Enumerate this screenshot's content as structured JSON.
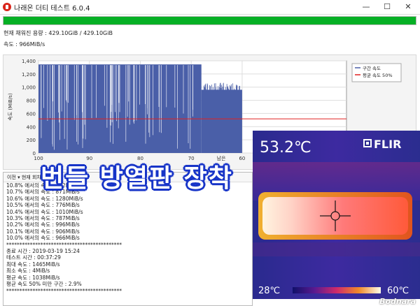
{
  "window": {
    "title": "나래온 더티 테스트 6.0.4",
    "min": "—",
    "max": "☐",
    "close": "✕"
  },
  "progress": {
    "fraction": 1.0,
    "color": "#06b025"
  },
  "status": {
    "capacity": "현재 채워진 용량 : 429.10GiB / 429.10GiB",
    "speed": "속도 : 966MiB/s"
  },
  "chart_data": {
    "type": "line",
    "ylabel": "속도 (MiB/s)",
    "ylim": [
      0,
      1400
    ],
    "yticks": [
      "0",
      "200",
      "400",
      "600",
      "800",
      "1,000",
      "1,200",
      "1,400"
    ],
    "xlim": [
      0,
      100
    ],
    "xticks": [
      "100",
      "90",
      "80",
      "70",
      "60"
    ],
    "x_label_partial": "남은",
    "series": [
      {
        "name": "구간 속도",
        "color": "#4a5fa8",
        "segments": [
          {
            "x_range": [
              100,
              68
            ],
            "baseline": 1345,
            "dips_to": 800
          },
          {
            "x_range": [
              68,
              60
            ],
            "baseline": 960
          }
        ]
      },
      {
        "name": "평균 속도 50%",
        "color": "#e02020",
        "value": 519
      }
    ],
    "legend_position": "right",
    "grid": true
  },
  "log": {
    "header": "이전  ▾  현재 회차",
    "lines": [
      "10.8% 에서의 속도 : 772MiB/s",
      "10.7% 에서의 속도 : 871MiB/s",
      "10.6% 에서의 속도 : 1280MiB/s",
      "10.5% 에서의 속도 : 776MiB/s",
      "10.4% 에서의 속도 : 1010MiB/s",
      "10.3% 에서의 속도 : 787MiB/s",
      "10.2% 에서의 속도 : 996MiB/s",
      "10.1% 에서의 속도 : 906MiB/s",
      "10.0% 에서의 속도 : 966MiB/s",
      "********************************************",
      "",
      "종료 시간 : 2019-03-19 15:24",
      "테스트 시간 : 00:37:29",
      "",
      "최대 속도 : 1465MiB/s",
      "최소 속도 : 4MiB/s",
      "평균 속도 : 1038MiB/s",
      "평균 속도 50% 미만 구간 : 2.9%",
      "********************************************"
    ]
  },
  "overlay": {
    "caption": "번들 방열판 장착"
  },
  "thermal": {
    "brand": "FLIR",
    "spot_temp": "53.2℃",
    "scale_min": "28℃",
    "scale_max": "60℃"
  },
  "watermark": "Bodnara"
}
